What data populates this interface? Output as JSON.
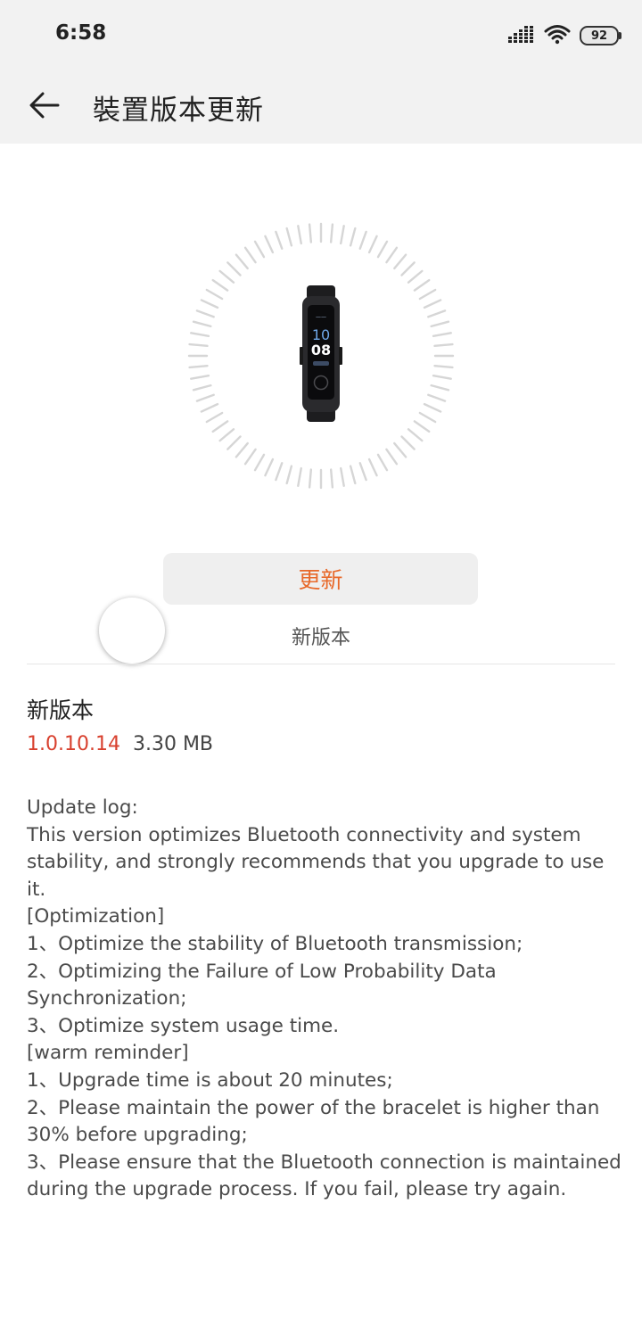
{
  "status_bar": {
    "time": "6:58",
    "battery": "92",
    "icons": [
      "signal-icon",
      "wifi-icon",
      "battery-icon"
    ]
  },
  "app_bar": {
    "title": "裝置版本更新",
    "back_icon": "back-arrow-icon"
  },
  "hero": {
    "image": "fitness-band-icon",
    "band_time": "08"
  },
  "actions": {
    "update_label": "更新",
    "status_text": "新版本"
  },
  "details": {
    "heading": "新版本",
    "version": "1.0.10.14",
    "size": "3.30 MB"
  },
  "changelog": [
    "Update log:",
    "This version optimizes Bluetooth connectivity and system stability, and strongly recommends that you upgrade to use it.",
    "[Optimization]",
    "1、Optimize the stability of Bluetooth transmission;",
    "2、Optimizing the Failure of Low Probability Data Synchronization;",
    "3、Optimize system usage time.",
    "[warm reminder]",
    "1、Upgrade time is about 20 minutes;",
    "2、Please maintain the power of the bracelet is higher than 30% before upgrading;",
    "3、Please ensure that the Bluetooth connection is maintained during the upgrade process. If you fail, please try again."
  ],
  "colors": {
    "accent": "#e8692a",
    "version": "#d8402e",
    "bar_background": "#f2f2f2"
  }
}
